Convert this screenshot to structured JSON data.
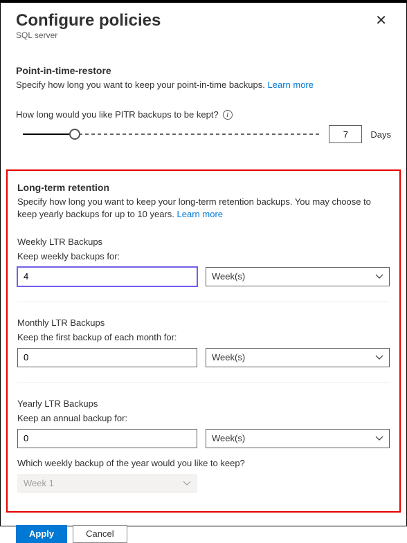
{
  "header": {
    "title": "Configure policies",
    "subtitle": "SQL server"
  },
  "pitr": {
    "title": "Point-in-time-restore",
    "desc": "Specify how long you want to keep your point-in-time backups.",
    "learn_more": "Learn more",
    "question": "How long would you like PITR backups to be kept?",
    "value": "7",
    "unit": "Days"
  },
  "ltr": {
    "title": "Long-term retention",
    "desc": "Specify how long you want to keep your long-term retention backups. You may choose to keep yearly backups for up to 10 years.",
    "learn_more": "Learn more",
    "weekly": {
      "label": "Weekly LTR Backups",
      "sublabel": "Keep weekly backups for:",
      "value": "4",
      "unit": "Week(s)"
    },
    "monthly": {
      "label": "Monthly LTR Backups",
      "sublabel": "Keep the first backup of each month for:",
      "value": "0",
      "unit": "Week(s)"
    },
    "yearly": {
      "label": "Yearly LTR Backups",
      "sublabel": "Keep an annual backup for:",
      "value": "0",
      "unit": "Week(s)",
      "question": "Which weekly backup of the year would you like to keep?",
      "week_value": "Week 1"
    }
  },
  "buttons": {
    "apply": "Apply",
    "cancel": "Cancel"
  }
}
